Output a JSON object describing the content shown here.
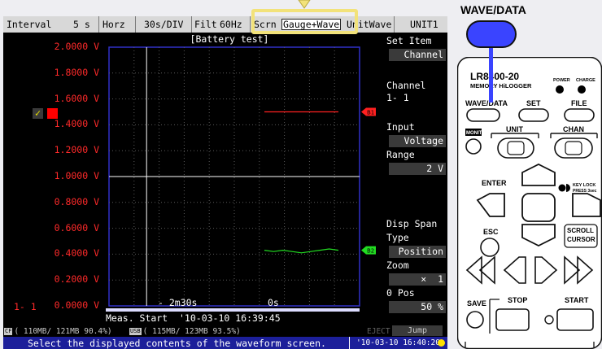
{
  "header": {
    "interval_label": "Interval",
    "interval_value": "5 s",
    "horz_label": "Horz",
    "timebase": "30s/DIV",
    "filter_label": "Filt",
    "filter_value": "60Hz",
    "scrn_label": "Scrn",
    "scrn_value": "Gauge+Wave",
    "unitwave": "UnitWave",
    "unit": "UNIT1"
  },
  "chart_data": {
    "type": "line",
    "title": "[Battery test]",
    "xlabel": "",
    "ylabel": "",
    "y_tick_labels": [
      "2.0000 V",
      "1.8000 V",
      "1.6000 V",
      "1.4000 V",
      "1.2000 V",
      "1.0000 V",
      "0.8000 V",
      "0.6000 V",
      "0.4000 V",
      "0.2000 V",
      "0.0000 V"
    ],
    "ylim": [
      0,
      2
    ],
    "x_tick_labels": [
      "- 2m30s",
      "0s"
    ],
    "grid": true,
    "series": [
      {
        "name": "",
        "color": "#ff2020",
        "start_fraction": 0.62,
        "values": [
          1.5,
          1.5,
          1.5,
          1.5,
          1.5,
          1.5,
          1.5,
          1.5,
          1.5
        ]
      },
      {
        "name": "",
        "color": "#22dd22",
        "start_fraction": 0.62,
        "values": [
          0.43,
          0.42,
          0.43,
          0.42,
          0.41,
          0.42,
          0.43,
          0.44,
          0.43
        ]
      }
    ],
    "markers": [
      {
        "label": "B1",
        "value": 1.5,
        "color": "#ff2020"
      },
      {
        "label": "B2",
        "value": 0.43,
        "color": "#22dd22"
      }
    ]
  },
  "channel_id": "1- 1",
  "measure": {
    "text": "Meas. Start  '10-03-10 16:39:45"
  },
  "sidebar": {
    "set_item_label": "Set Item",
    "set_item_value": "Channel",
    "channel_label": "Channel",
    "channel_value": "1- 1",
    "channel_check": "✓",
    "input_label": "Input",
    "input_value": "Voltage",
    "range_label": "Range",
    "range_value": "2 V",
    "disp_span_label": "Disp Span",
    "type_label": "Type",
    "type_value": "Position",
    "zoom_label": "Zoom",
    "zoom_value": "×  1",
    "pos_label": "0 Pos",
    "pos_value": "50 %"
  },
  "status": {
    "cf_badge": "CF",
    "cf_text": "( 110MB/ 121MB 90.4%)",
    "usb_badge": "USB",
    "usb_text": "( 115MB/ 123MB 93.5%)",
    "eject": "EJECT",
    "jump": "Jump"
  },
  "footer": {
    "message": "Select the displayed contents of the waveform screen.",
    "time": "'10-03-10 16:40:20"
  },
  "panel": {
    "wave_data_callout": "WAVE/DATA",
    "model": "LR8400-20",
    "model_sub": "MEMORY HiLOGGER",
    "power": "POWER",
    "charge": "CHARGE",
    "wave_data": "WAVE/DATA",
    "set": "SET",
    "file": "FILE",
    "monit": "MONIT",
    "unit": "UNIT",
    "chan": "CHAN",
    "enter": "ENTER",
    "key_lock": "KEY LOCK",
    "press": "PRESS 3sec",
    "esc": "ESC",
    "scroll": "SCROLL",
    "cursor": "CURSOR",
    "save": "SAVE",
    "stop": "STOP",
    "start": "START"
  },
  "colors": {
    "accent_blue": "#3a44ff",
    "footer_blue": "#1c1f9a",
    "highlight": "#f2e27a",
    "axis_red": "#ff2a2a"
  }
}
